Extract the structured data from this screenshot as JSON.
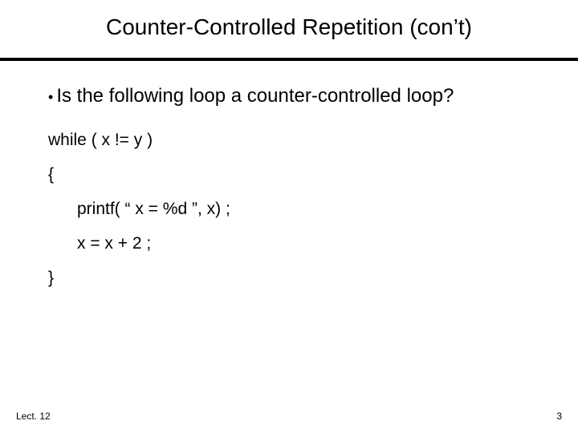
{
  "title": "Counter-Controlled Repetition (con’t)",
  "bullet": {
    "marker": "•",
    "text": "Is the following loop a counter-controlled loop?"
  },
  "code": {
    "l1": "while ( x != y )",
    "l2": "{",
    "l3": "printf( “ x = %d ”, x) ;",
    "l4": "x = x + 2 ;",
    "l5": "}"
  },
  "footer": {
    "left": "Lect. 12",
    "right": "3"
  }
}
